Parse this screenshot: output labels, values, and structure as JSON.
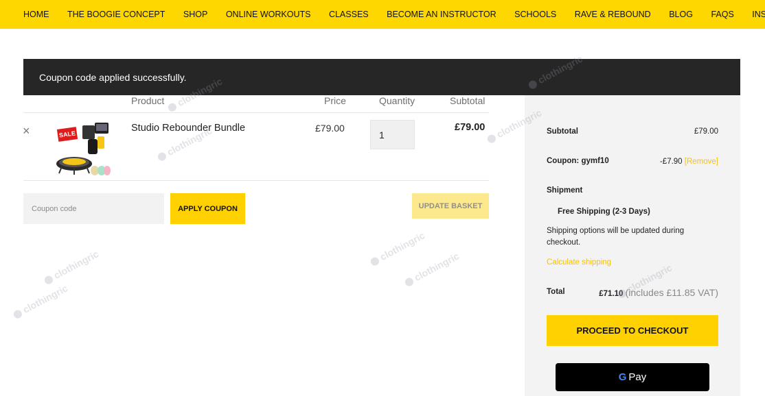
{
  "nav": {
    "items": [
      "HOME",
      "THE BOOGIE CONCEPT",
      "SHOP",
      "ONLINE WORKOUTS",
      "CLASSES",
      "BECOME AN INSTRUCTOR",
      "SCHOOLS",
      "RAVE & REBOUND",
      "BLOG",
      "FAQS",
      "INSTRUCTOR PORTAL"
    ]
  },
  "notice": "Coupon code applied successfully.",
  "table": {
    "headers": {
      "product": "Product",
      "price": "Price",
      "quantity": "Quantity",
      "subtotal": "Subtotal"
    },
    "rows": [
      {
        "remove": "×",
        "name": "Studio Rebounder Bundle",
        "price": "£79.00",
        "quantity": "1",
        "subtotal": "£79.00",
        "sale_badge": "SALE"
      }
    ]
  },
  "coupon": {
    "placeholder": "Coupon code",
    "apply_label": "APPLY COUPON"
  },
  "update_label": "UPDATE BASKET",
  "totals": {
    "subtotal_label": "Subtotal",
    "subtotal_value": "£79.00",
    "coupon_label": "Coupon: gymf10",
    "coupon_value": "-£7.90",
    "coupon_remove": "[Remove]",
    "shipment_label": "Shipment",
    "shipping_option": "Free Shipping (2-3 Days)",
    "shipping_note": "Shipping options will be updated during checkout.",
    "calculate_shipping": "Calculate shipping",
    "total_label": "Total",
    "total_value": "£71.10",
    "total_vat": "(includes £11.85 VAT)"
  },
  "checkout_label": "PROCEED TO CHECKOUT",
  "gpay": {
    "g": "G",
    "label": "Pay"
  },
  "watermark": "clothingric",
  "colors": {
    "nav_bg": "#ffd700",
    "accent": "#ffd100",
    "notice_bg": "#262626",
    "link": "#f4c10a"
  }
}
